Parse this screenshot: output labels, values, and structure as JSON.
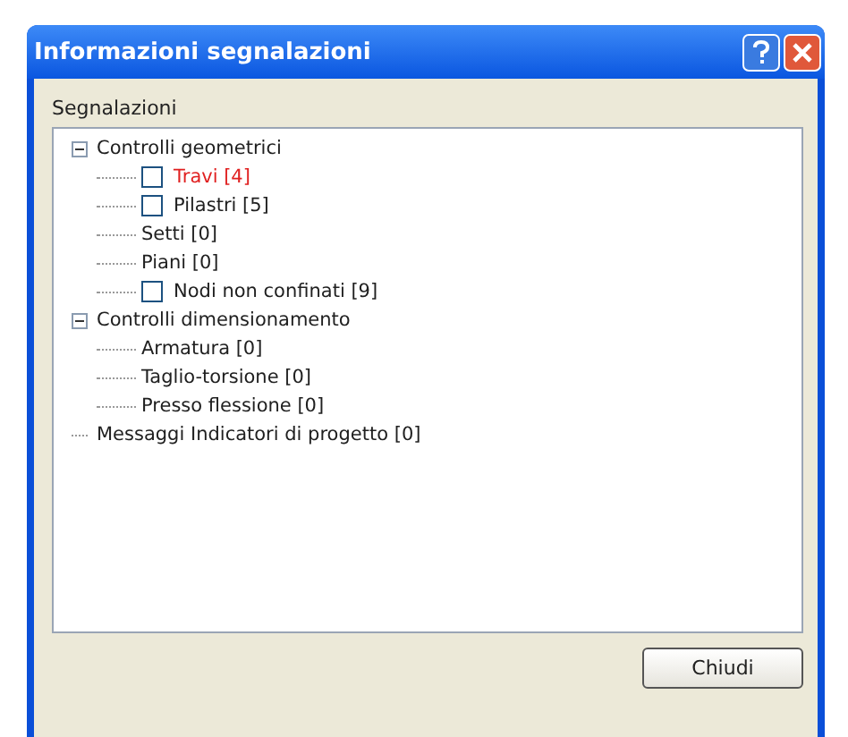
{
  "window": {
    "title": "Informazioni segnalazioni"
  },
  "group_label": "Segnalazioni",
  "tree": [
    {
      "label": "Controlli geometrici",
      "expanded": true,
      "children": [
        {
          "label": "Travi [4]",
          "kind": "checkbox",
          "checked": false,
          "color": "#e02020"
        },
        {
          "label": "Pilastri [5]",
          "kind": "checkbox",
          "checked": false,
          "color": "#202020"
        },
        {
          "label": "Setti [0]",
          "kind": "plain",
          "color": "#202020"
        },
        {
          "label": "Piani [0]",
          "kind": "plain",
          "color": "#202020"
        },
        {
          "label": "Nodi non confinati [9]",
          "kind": "checkbox",
          "checked": false,
          "color": "#202020"
        }
      ]
    },
    {
      "label": "Controlli dimensionamento",
      "expanded": true,
      "children": [
        {
          "label": "Armatura [0]",
          "kind": "plain",
          "color": "#202020"
        },
        {
          "label": "Taglio-torsione [0]",
          "kind": "plain",
          "color": "#202020"
        },
        {
          "label": "Presso flessione [0]",
          "kind": "plain",
          "color": "#202020"
        }
      ]
    },
    {
      "label": "Messaggi Indicatori di progetto [0]"
    }
  ],
  "buttons": [
    "Chiudi"
  ]
}
